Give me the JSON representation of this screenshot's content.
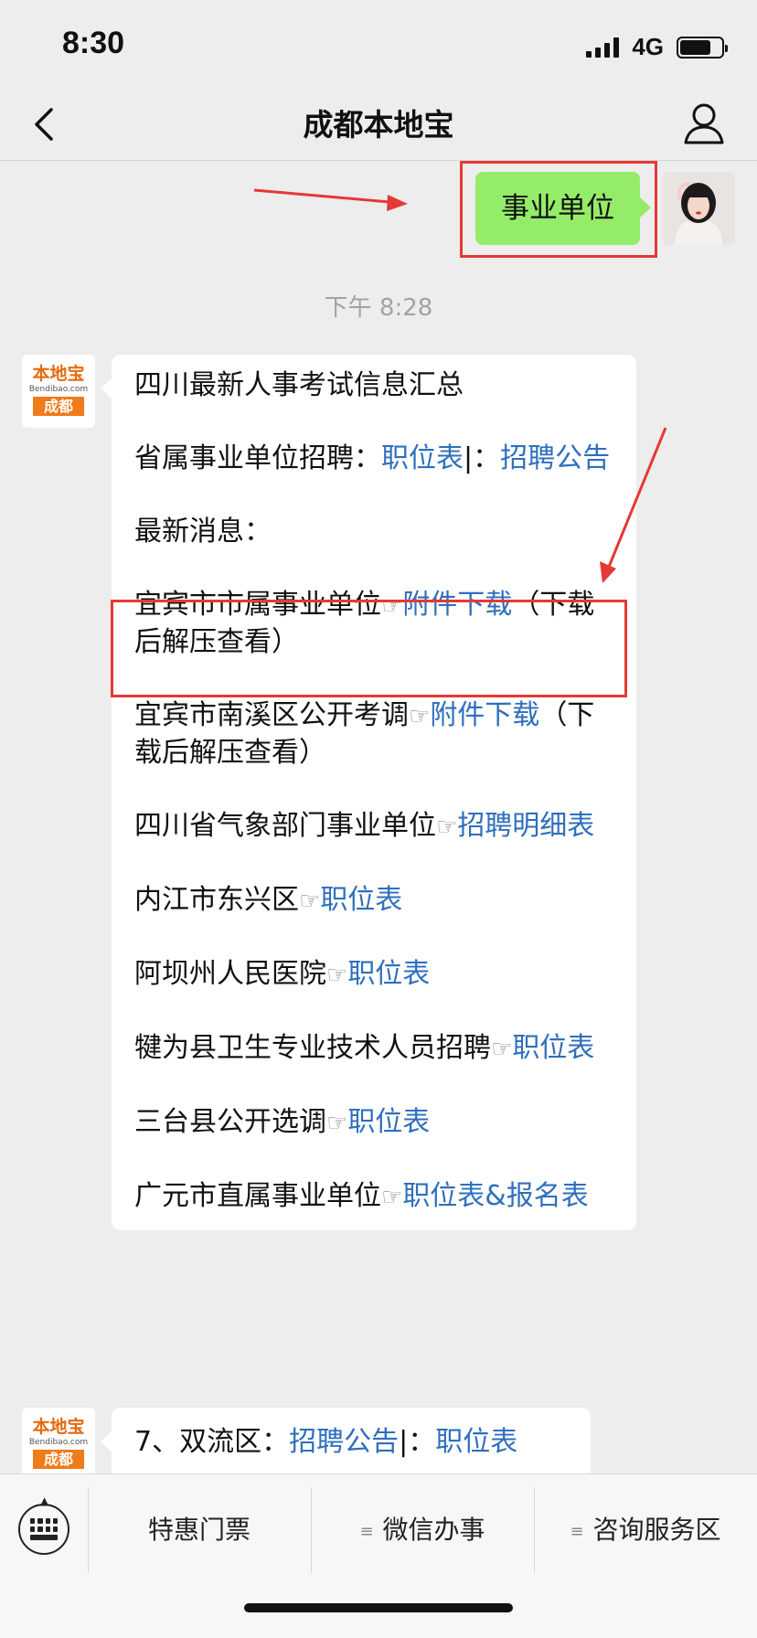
{
  "status": {
    "time": "8:30",
    "network": "4G",
    "battery_level": 0.74
  },
  "nav": {
    "title": "成都本地宝"
  },
  "chat": {
    "user_message": "事业单位",
    "timestamp": "下午 8:28",
    "bot_avatar": {
      "line1": "本地宝",
      "line2": "Bendibao.com",
      "line3": "成都"
    },
    "bot_message": {
      "title": "四川最新人事考试信息汇总",
      "provincial": {
        "text": "省属事业单位招聘：",
        "link1": "职位表",
        "sep": "|：",
        "link2": "招聘公告"
      },
      "latest_label": "最新消息：",
      "items": [
        {
          "text": "宜宾市市属事业单位",
          "link": "附件下载",
          "suffix": "（下载后解压查看）"
        },
        {
          "text": "宜宾市南溪区公开考调",
          "link": "附件下载",
          "suffix": "（下载后解压查看）"
        },
        {
          "text": "四川省气象部门事业单位",
          "link": "招聘明细表",
          "suffix": ""
        },
        {
          "text": "内江市东兴区",
          "link": "职位表",
          "suffix": ""
        },
        {
          "text": "阿坝州人民医院",
          "link": "职位表",
          "suffix": ""
        },
        {
          "text": "犍为县卫生专业技术人员招聘",
          "link": "职位表",
          "suffix": ""
        },
        {
          "text": "三台县公开选调",
          "link": "职位表",
          "suffix": ""
        },
        {
          "text": "广元市直属事业单位",
          "link": "职位表&报名表",
          "suffix": ""
        }
      ],
      "hand_glyph": "☞"
    },
    "bot_message2": {
      "text": "7、双流区：",
      "link1": "招聘公告",
      "sep": "|：",
      "link2": "职位表"
    }
  },
  "bottom_menu": {
    "items": [
      {
        "label": "特惠门票",
        "icon": ""
      },
      {
        "label": "微信办事",
        "icon": "≡"
      },
      {
        "label": "咨询服务区",
        "icon": "≡"
      }
    ]
  },
  "colors": {
    "bubble_green": "#95ec69",
    "link_blue": "#2f6fbd",
    "highlight_red": "#e53935"
  }
}
